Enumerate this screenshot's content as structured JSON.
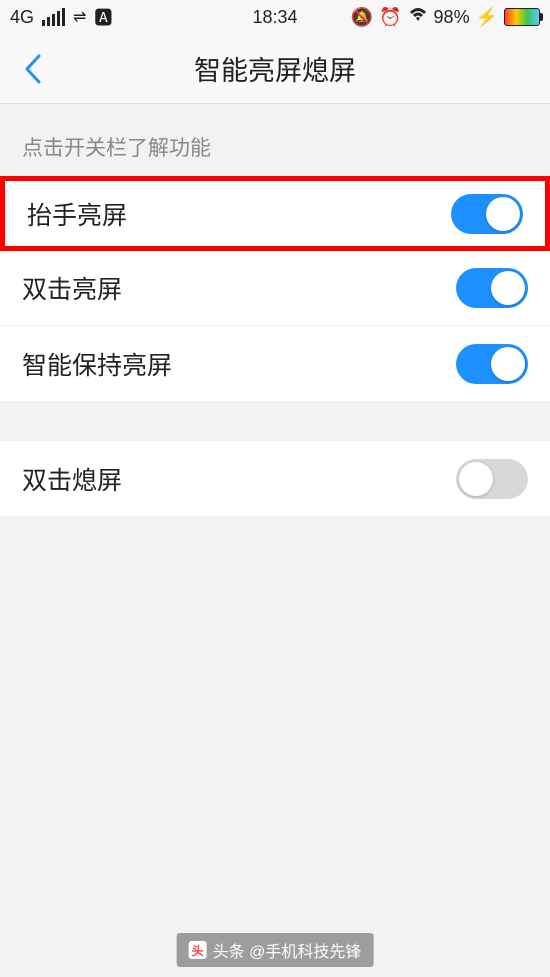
{
  "status": {
    "network": "4G",
    "time": "18:34",
    "battery_pct": "98%",
    "charging": "⚡"
  },
  "header": {
    "title": "智能亮屏熄屏"
  },
  "section_label": "点击开关栏了解功能",
  "settings": {
    "raise_to_wake": {
      "label": "抬手亮屏",
      "on": true
    },
    "double_tap_wake": {
      "label": "双击亮屏",
      "on": true
    },
    "smart_keep_on": {
      "label": "智能保持亮屏",
      "on": true
    },
    "double_tap_off": {
      "label": "双击熄屏",
      "on": false
    }
  },
  "watermark": "头条 @手机科技先锋"
}
